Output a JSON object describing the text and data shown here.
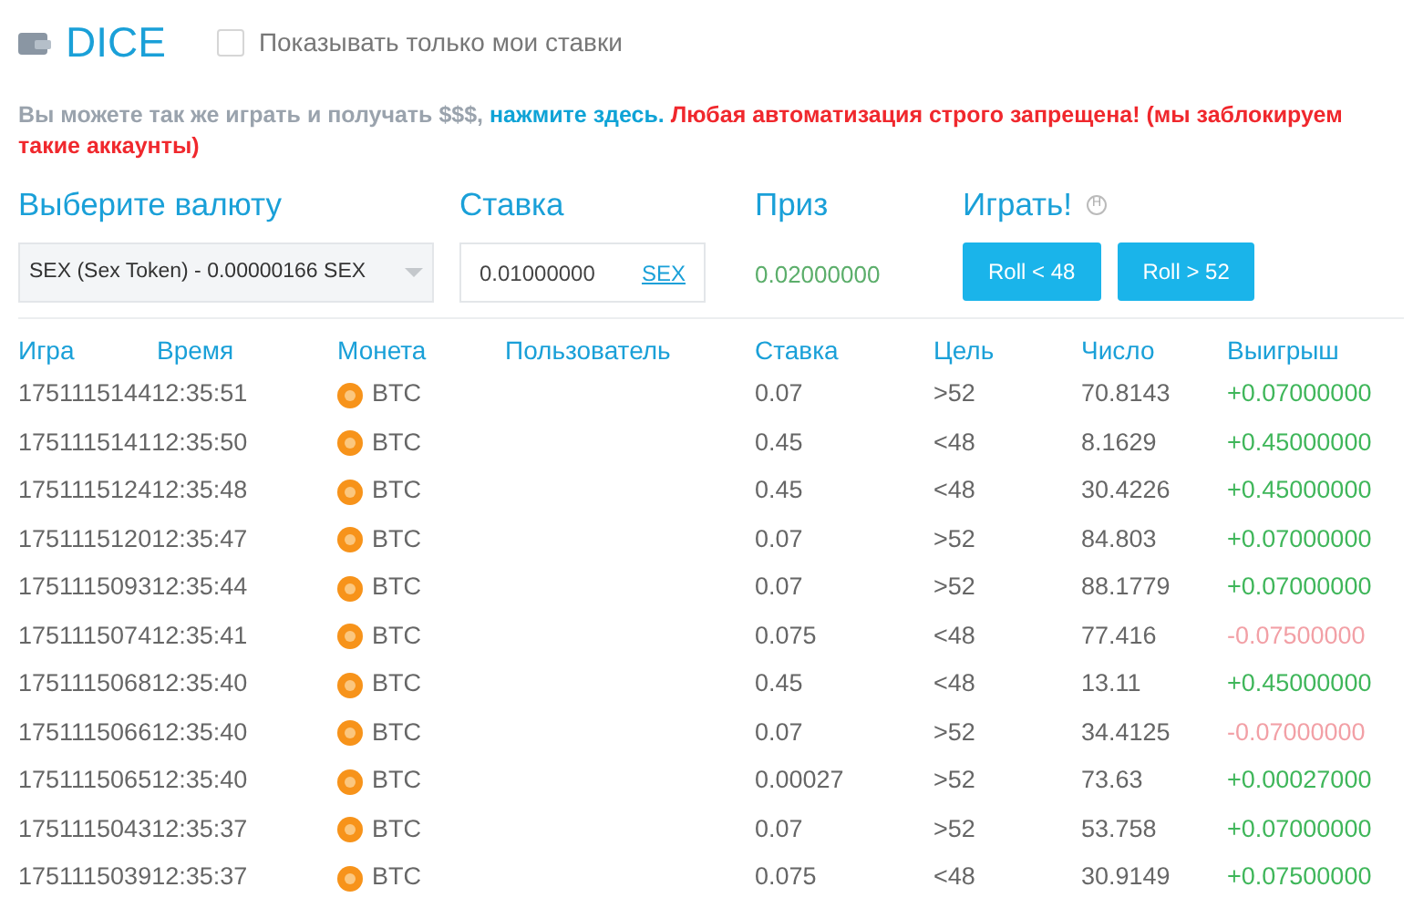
{
  "header": {
    "title": "DICE",
    "filter": {
      "label": "Показывать только мои ставки",
      "checked": false
    }
  },
  "notice": {
    "text": "Вы можете так же играть и получать $$$,",
    "link": "нажмите здесь.",
    "warning": "Любая автоматизация строго запрещена! (мы заблокируем такие аккаунты)"
  },
  "bet_form": {
    "currency": {
      "label": "Выберите валюту",
      "value": "SEX (Sex Token) - 0.00000166 SEX"
    },
    "stake": {
      "label": "Ставка",
      "value": "0.01000000",
      "unit": "SEX"
    },
    "prize": {
      "label": "Приз",
      "value": "0.02000000"
    },
    "play": {
      "label": "Играть!",
      "hotkey": "H",
      "buttons": [
        "Roll < 48",
        "Roll > 52"
      ]
    }
  },
  "table": {
    "columns": [
      "Игра",
      "Время",
      "Монета",
      "Пользователь",
      "Ставка",
      "Цель",
      "Число",
      "Выигрыш"
    ],
    "rows": [
      {
        "game": "1751115144",
        "time": "12:35:51",
        "coin": "BTC",
        "stake": "0.07",
        "target": ">52",
        "number": "70.8143",
        "profit": "+0.07000000",
        "kind": "win"
      },
      {
        "game": "1751115141",
        "time": "12:35:50",
        "coin": "BTC",
        "stake": "0.45",
        "target": "<48",
        "number": "8.1629",
        "profit": "+0.45000000",
        "kind": "win"
      },
      {
        "game": "1751115124",
        "time": "12:35:48",
        "coin": "BTC",
        "stake": "0.45",
        "target": "<48",
        "number": "30.4226",
        "profit": "+0.45000000",
        "kind": "win"
      },
      {
        "game": "1751115120",
        "time": "12:35:47",
        "coin": "BTC",
        "stake": "0.07",
        "target": ">52",
        "number": "84.803",
        "profit": "+0.07000000",
        "kind": "win"
      },
      {
        "game": "1751115093",
        "time": "12:35:44",
        "coin": "BTC",
        "stake": "0.07",
        "target": ">52",
        "number": "88.1779",
        "profit": "+0.07000000",
        "kind": "win"
      },
      {
        "game": "1751115074",
        "time": "12:35:41",
        "coin": "BTC",
        "stake": "0.075",
        "target": "<48",
        "number": "77.416",
        "profit": "-0.07500000",
        "kind": "loss"
      },
      {
        "game": "1751115068",
        "time": "12:35:40",
        "coin": "BTC",
        "stake": "0.45",
        "target": "<48",
        "number": "13.11",
        "profit": "+0.45000000",
        "kind": "win"
      },
      {
        "game": "1751115066",
        "time": "12:35:40",
        "coin": "BTC",
        "stake": "0.07",
        "target": ">52",
        "number": "34.4125",
        "profit": "-0.07000000",
        "kind": "loss"
      },
      {
        "game": "1751115065",
        "time": "12:35:40",
        "coin": "BTC",
        "stake": "0.00027",
        "target": ">52",
        "number": "73.63",
        "profit": "+0.00027000",
        "kind": "win"
      },
      {
        "game": "1751115043",
        "time": "12:35:37",
        "coin": "BTC",
        "stake": "0.07",
        "target": ">52",
        "number": "53.758",
        "profit": "+0.07000000",
        "kind": "win"
      },
      {
        "game": "1751115039",
        "time": "12:35:37",
        "coin": "BTC",
        "stake": "0.075",
        "target": "<48",
        "number": "30.9149",
        "profit": "+0.07500000",
        "kind": "win"
      }
    ]
  }
}
